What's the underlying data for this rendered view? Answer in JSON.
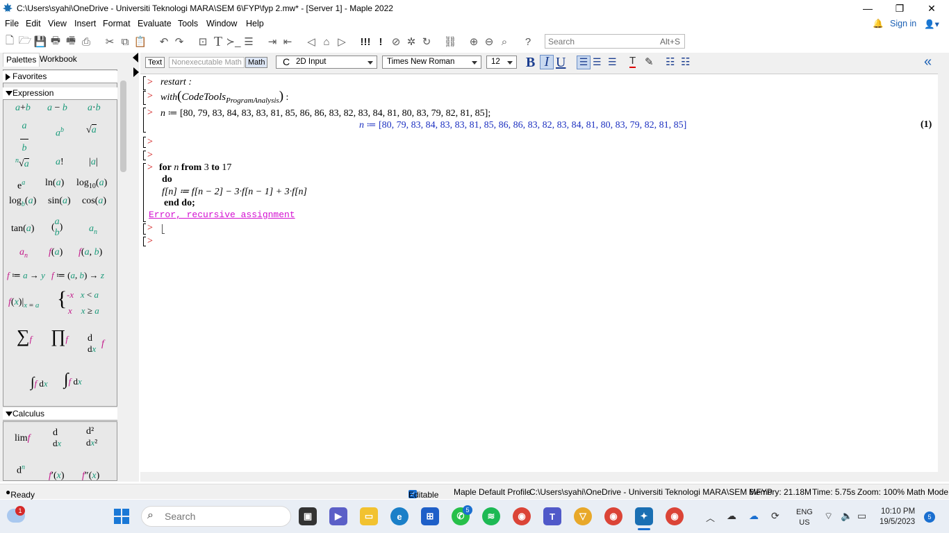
{
  "window": {
    "title": "C:\\Users\\syahi\\OneDrive - Universiti Teknologi MARA\\SEM 6\\FYP\\fyp 2.mw* - [Server 1] - Maple 2022",
    "minimize": "—",
    "restore": "❐",
    "close": "✕"
  },
  "menu": {
    "items": [
      "File",
      "Edit",
      "View",
      "Insert",
      "Format",
      "Evaluate",
      "Tools",
      "Window",
      "Help"
    ],
    "sign_in": "Sign in"
  },
  "toolbar": {
    "search_placeholder": "Search",
    "search_shortcut": "Alt+S"
  },
  "palettes": {
    "tab_palettes": "Palettes",
    "tab_workbook": "Workbook",
    "favorites": "Favorites",
    "expression": "Expression",
    "calculus": "Calculus"
  },
  "format_bar": {
    "text": "Text",
    "nonexec": "Nonexecutable Math",
    "math": "Math",
    "input_mode": "2D Input",
    "font": "Times New Roman",
    "size": "12",
    "bold": "B",
    "italic": "I",
    "underline": "U"
  },
  "worksheet": {
    "restart": "restart :",
    "with_prefix": "with",
    "with_pkg": "CodeTools",
    "with_sub": "ProgramAnalysis",
    "with_end": " :",
    "n_assign_input": "[80, 79, 83, 84, 83, 83, 81, 85, 86, 86, 83, 82, 83, 84, 81, 80, 83, 79, 82, 81, 85];",
    "n_assign_output": "[80, 79, 83, 84, 83, 83, 81, 85, 86, 86, 83, 82, 83, 84, 81, 80, 83, 79, 82, 81, 85]",
    "eq_label": "(1)",
    "loop_for": "for",
    "loop_var": "n",
    "loop_from": "from",
    "loop_start": "3",
    "loop_to": "to",
    "loop_end_val": "17",
    "loop_do": "do",
    "loop_body": "f[n] ≔ f[n − 2] − 3·f[n − 1] + 3·f[n]",
    "loop_end": "end do;",
    "error": "Error, recursive assignment"
  },
  "status": {
    "ready": "Ready",
    "editable": "Editable",
    "profile": "Maple Default Profile",
    "path": "C:\\Users\\syahi\\OneDrive - Universiti Teknologi MARA\\SEM 6\\FYP",
    "memory": "Memory: 21.18M",
    "time": "Time: 5.75s",
    "zoom": "Zoom: 100%",
    "mode": "Math Mode"
  },
  "taskbar": {
    "search_placeholder": "Search",
    "weather_badge": "1",
    "whatsapp_badge": "5",
    "lang_top": "ENG",
    "lang_bottom": "US",
    "clock_time": "10:10 PM",
    "clock_date": "19/5/2023",
    "notif_badge": "5"
  },
  "colors": {
    "accent": "#1b2fc0",
    "error": "#d30fd0",
    "prompt": "#cc0000"
  }
}
